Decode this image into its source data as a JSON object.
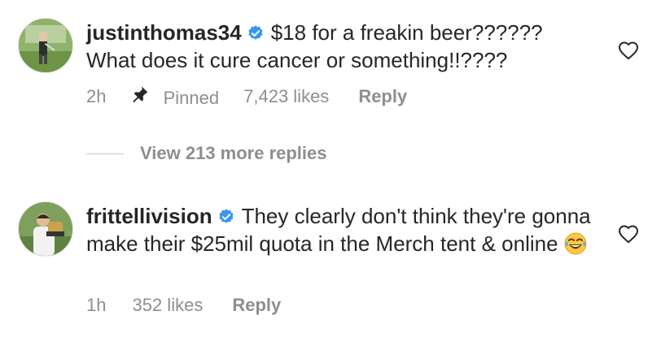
{
  "comments": [
    {
      "username": "justinthomas34",
      "text": "$18 for a freakin beer?????? What does it cure cancer or something!!????",
      "time": "2h",
      "pinned_label": "Pinned",
      "likes": "7,423 likes",
      "reply_label": "Reply",
      "verified": true
    },
    {
      "username": "frittellivision",
      "text": "They clearly don't think they're gonna make their $25mil quota in the Merch tent & online",
      "time": "1h",
      "likes": "352 likes",
      "reply_label": "Reply",
      "verified": true,
      "emoji": "face-with-tears-of-joy"
    }
  ],
  "view_replies_label": "View 213 more replies",
  "icons": {
    "verified": "verified-badge-icon",
    "pin": "pin-icon",
    "like": "heart-icon"
  },
  "colors": {
    "text": "#262626",
    "secondary": "#8e8e8e",
    "verified": "#3897f0",
    "background": "#ffffff"
  }
}
